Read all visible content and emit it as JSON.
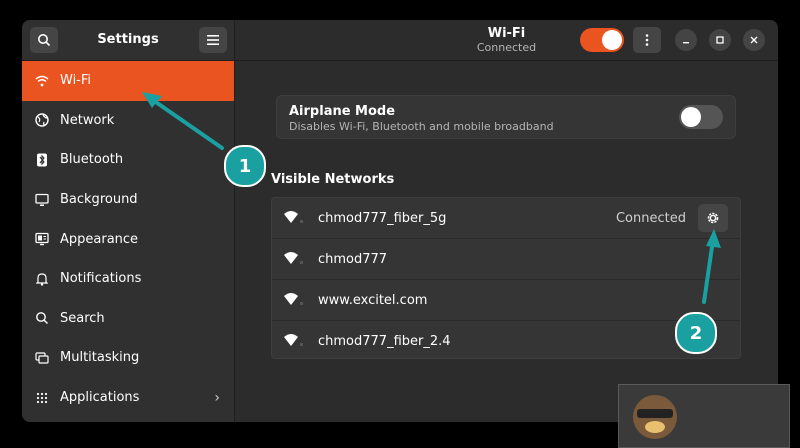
{
  "sidebar": {
    "title": "Settings",
    "search_icon": "search-icon",
    "menu_icon": "hamburger-menu-icon",
    "items": [
      {
        "label": "Wi-Fi",
        "icon": "wifi-icon",
        "active": true
      },
      {
        "label": "Network",
        "icon": "network-globe-icon"
      },
      {
        "label": "Bluetooth",
        "icon": "bluetooth-icon"
      },
      {
        "label": "Background",
        "icon": "background-monitor-icon"
      },
      {
        "label": "Appearance",
        "icon": "appearance-icon"
      },
      {
        "label": "Notifications",
        "icon": "bell-icon"
      },
      {
        "label": "Search",
        "icon": "search-icon"
      },
      {
        "label": "Multitasking",
        "icon": "multitasking-icon"
      },
      {
        "label": "Applications",
        "icon": "apps-grid-icon",
        "has_submenu": true
      }
    ]
  },
  "header": {
    "title": "Wi-Fi",
    "subtitle": "Connected",
    "wifi_toggle_on": true
  },
  "airplane": {
    "title": "Airplane Mode",
    "subtitle": "Disables Wi-Fi, Bluetooth and mobile broadband",
    "enabled": false
  },
  "visible_networks": {
    "title": "Visible Networks",
    "networks": [
      {
        "name": "chmod777_fiber_5g",
        "status": "Connected",
        "settings": true
      },
      {
        "name": "chmod777"
      },
      {
        "name": "www.excitel.com"
      },
      {
        "name": "chmod777_fiber_2.4"
      }
    ]
  },
  "annotations": {
    "badge1": "1",
    "badge2": "2"
  },
  "colors": {
    "accent": "#e95420",
    "annotation": "#1aa0a0",
    "window_bg": "#2c2c2c",
    "sidebar_bg": "#303030"
  }
}
